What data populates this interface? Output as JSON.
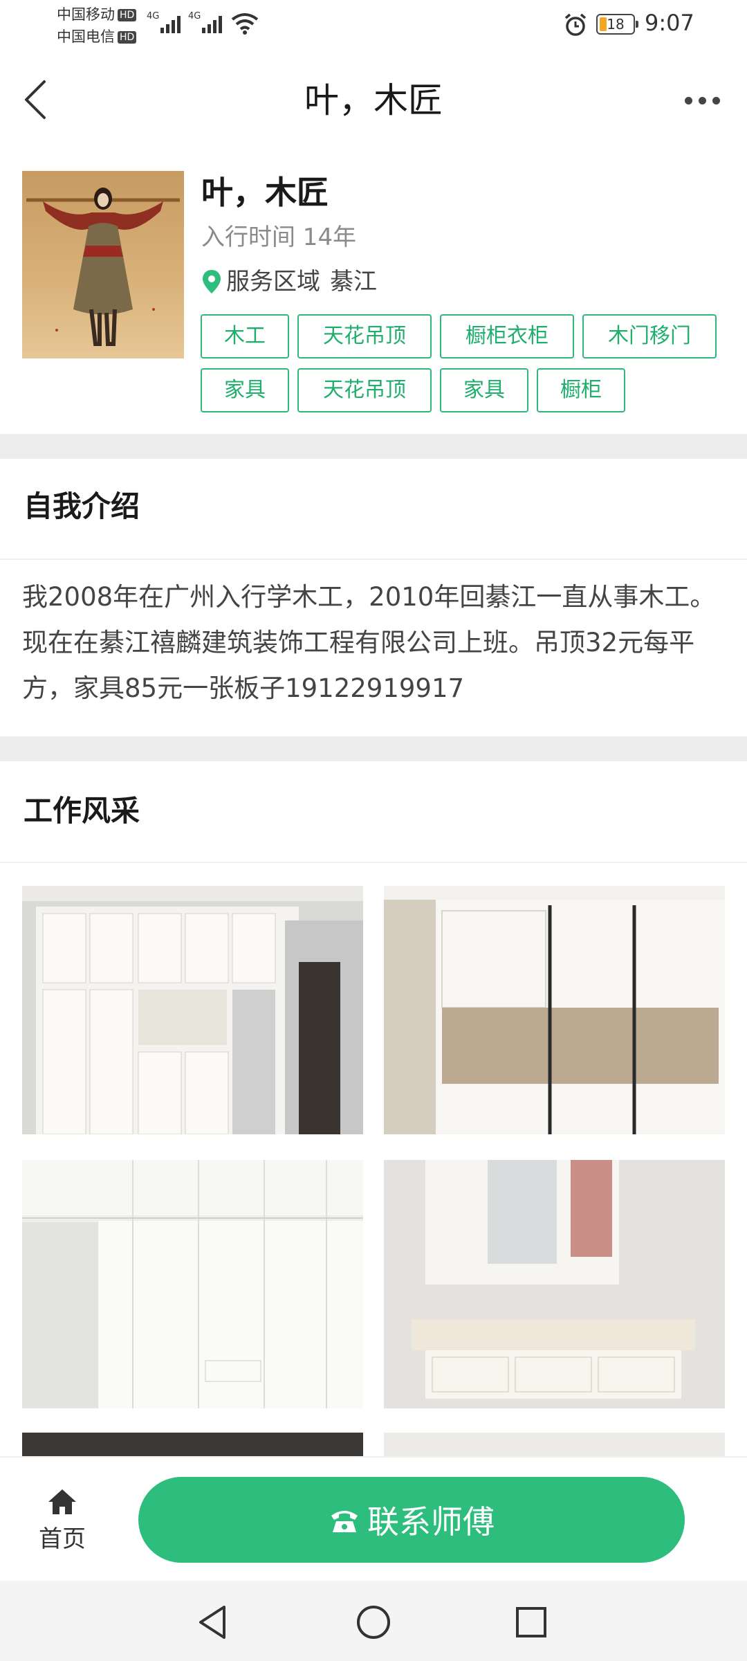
{
  "status_bar": {
    "carrier1": "中国移动",
    "carrier2": "中国电信",
    "hd": "HD",
    "net": "4G",
    "battery": "18",
    "time": "9:07"
  },
  "header": {
    "title": "叶，木匠"
  },
  "profile": {
    "name": "叶，木匠",
    "years": "入行时间 14年",
    "area_label": "服务区域",
    "area_value": "綦江",
    "tags": [
      "木工",
      "天花吊顶",
      "橱柜衣柜",
      "木门移门",
      "家具",
      "天花吊顶",
      "家具",
      "橱柜"
    ]
  },
  "intro": {
    "title": "自我介绍",
    "text": "我2008年在广州入行学木工，2010年回綦江一直从事木工。现在在綦江禧麟建筑装饰工程有限公司上班。吊顶32元每平方，家具85元一张板子19122919917"
  },
  "gallery": {
    "title": "工作风采"
  },
  "bottom": {
    "home_label": "首页",
    "contact_label": "联系师傅"
  },
  "colors": {
    "accent": "#2dbe7d",
    "tag_border": "#2fb67a"
  }
}
